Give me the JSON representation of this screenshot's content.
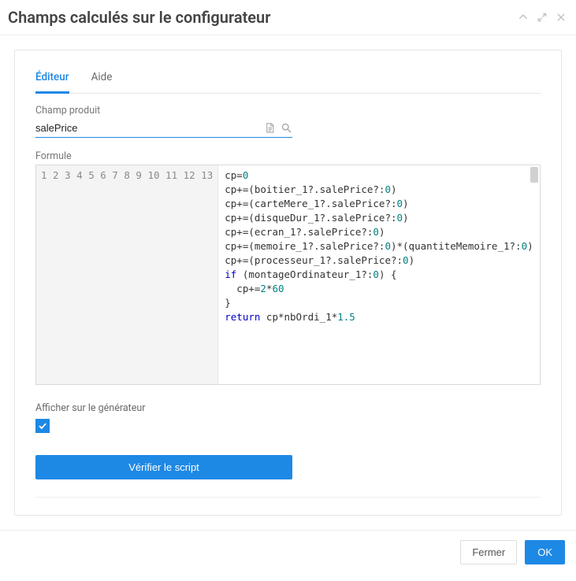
{
  "header": {
    "title": "Champs calculés sur le configurateur"
  },
  "tabs": {
    "editor": "Éditeur",
    "help": "Aide"
  },
  "productField": {
    "label": "Champ produit",
    "value": "salePrice"
  },
  "formula": {
    "label": "Formule",
    "lines": [
      "cp=0",
      "cp+=(boitier_1?.salePrice?:0)",
      "cp+=(carteMere_1?.salePrice?:0)",
      "cp+=(disqueDur_1?.salePrice?:0)",
      "cp+=(ecran_1?.salePrice?:0)",
      "cp+=(memoire_1?.salePrice?:0)*(quantiteMemoire_1?:0)",
      "cp+=(processeur_1?.salePrice?:0)",
      "if (montageOrdinateur_1?:0) {",
      "  cp+=2*60",
      "}",
      "return cp*nbOrdi_1*1.5",
      "",
      ""
    ]
  },
  "showOnGenerator": {
    "label": "Afficher sur le générateur",
    "checked": true
  },
  "buttons": {
    "verify": "Vérifier le script",
    "close": "Fermer",
    "ok": "OK"
  }
}
